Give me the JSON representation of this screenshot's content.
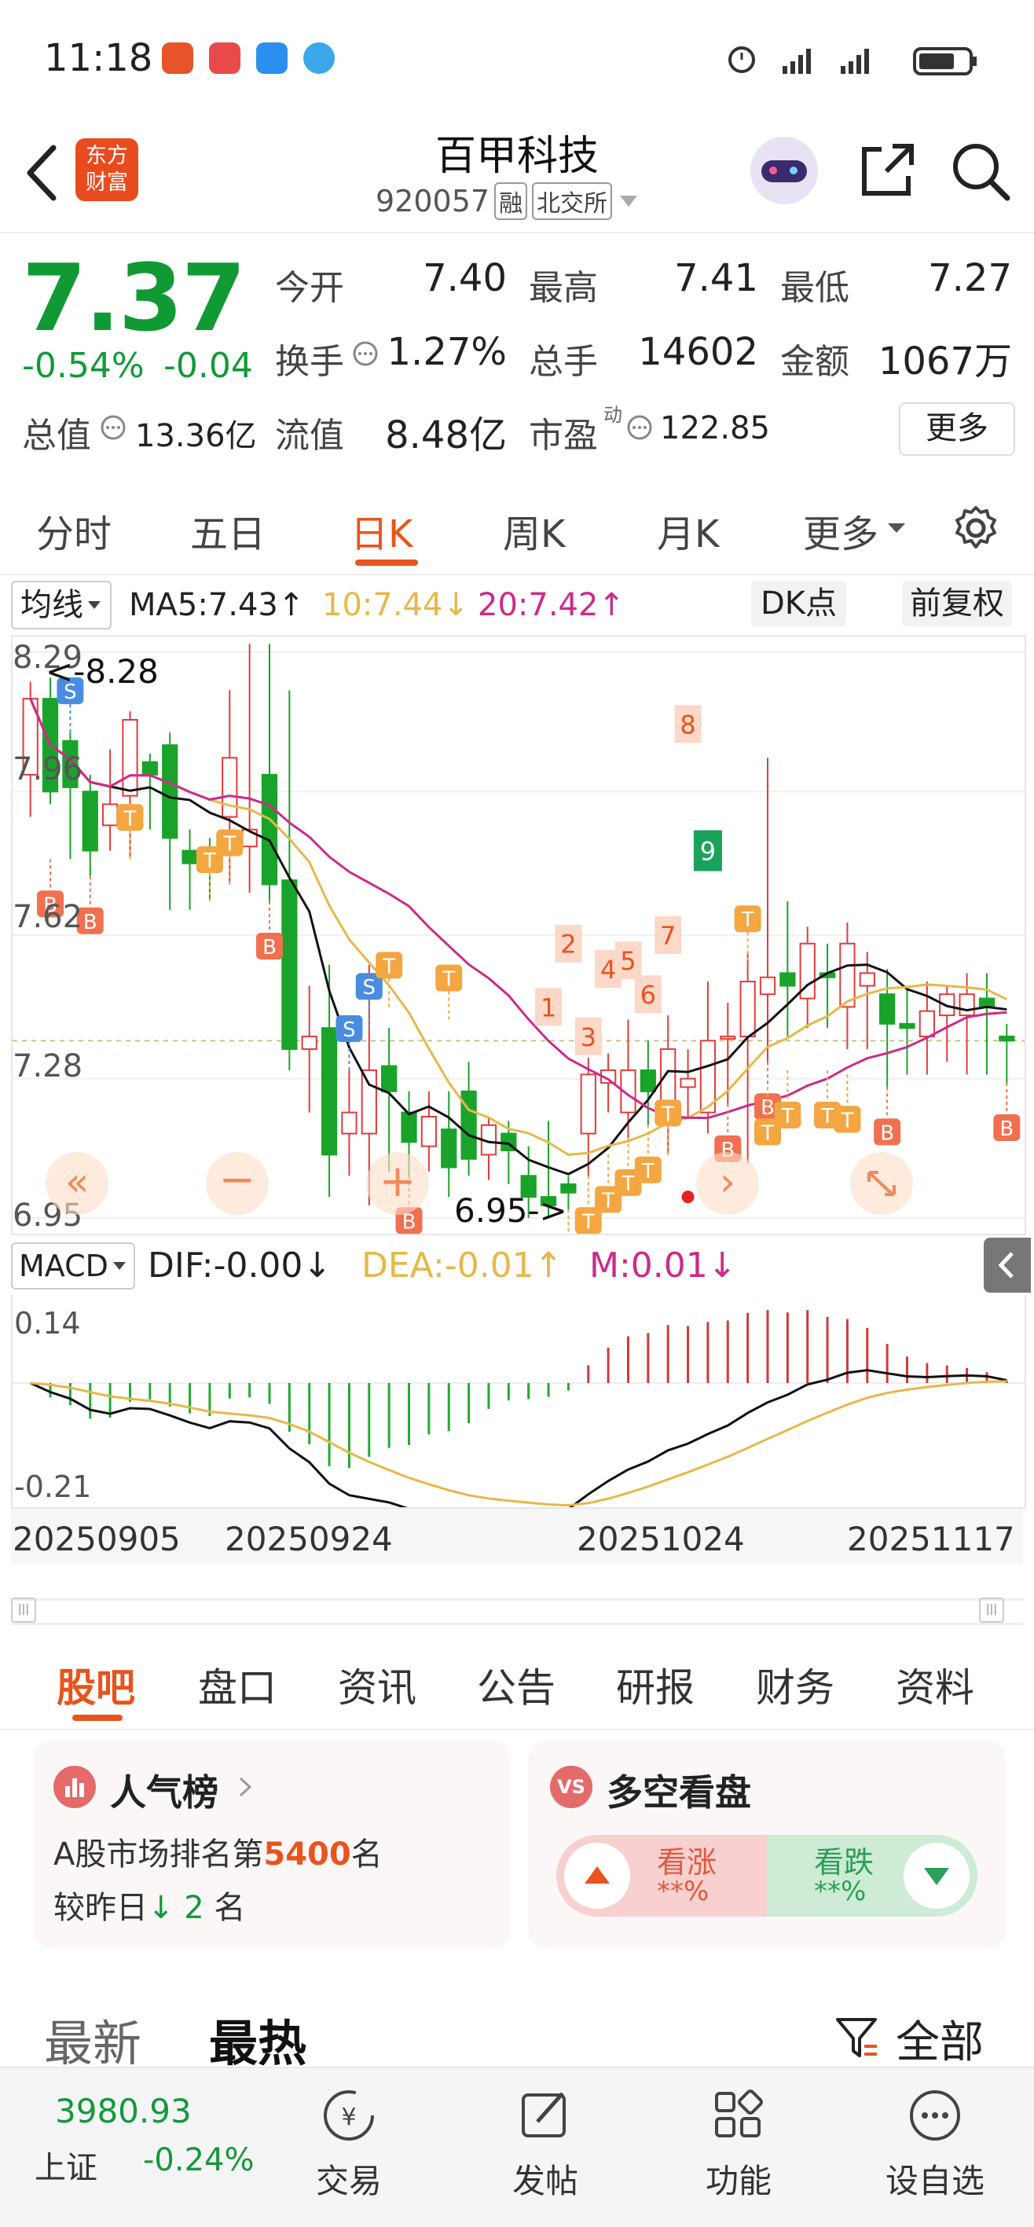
{
  "status": {
    "time": "11:18"
  },
  "header": {
    "title": "百甲科技",
    "code": "920057",
    "tag1": "融",
    "tag2": "北交所",
    "logo_line1": "东方",
    "logo_line2": "财富"
  },
  "quote": {
    "price": "7.37",
    "change_pct": "-0.54%",
    "change": "-0.04",
    "open_label": "今开",
    "open": "7.40",
    "high_label": "最高",
    "high": "7.41",
    "low_label": "最低",
    "low": "7.27",
    "turnover_label": "换手",
    "turnover": "1.27%",
    "volume_label": "总手",
    "volume": "14602",
    "amount_label": "金额",
    "amount": "1067万",
    "mcap_label": "总值",
    "mcap": "13.36亿",
    "float_label": "流值",
    "float": "8.48亿",
    "pe_label": "市盈",
    "pe_sup": "动",
    "pe": "122.85",
    "more": "更多"
  },
  "kline_tabs": [
    "分时",
    "五日",
    "日K",
    "周K",
    "月K",
    "更多"
  ],
  "kline_tab_active": 2,
  "ma": {
    "selector": "均线",
    "ma5": "MA5:7.43↑",
    "ma10": "10:7.44↓",
    "ma20": "20:7.42↑",
    "dk": "DK点",
    "adj": "前复权"
  },
  "chart_labels": {
    "y_ticks": [
      "8.29",
      "7.96",
      "7.62",
      "7.28",
      "6.95"
    ],
    "max_label": "8.28",
    "min_label": "6.95->",
    "macd_top": "0.14",
    "macd_bottom": "-0.21"
  },
  "macd": {
    "selector": "MACD",
    "dif": "DIF:-0.00↓",
    "dea": "DEA:-0.01↑",
    "m": "M:0.01↓"
  },
  "dates": [
    "20250905",
    "20250924",
    "20251024",
    "20251117"
  ],
  "markers": {
    "B": "B",
    "S": "S",
    "T": "T",
    "nums": [
      "1",
      "2",
      "3",
      "4",
      "5",
      "6",
      "7",
      "8",
      "9"
    ]
  },
  "bottom_tabs": [
    "股吧",
    "盘口",
    "资讯",
    "公告",
    "研报",
    "财务",
    "资料"
  ],
  "bottom_tab_active": 0,
  "popularity": {
    "title": "人气榜",
    "line1_pre": "A股市场排名第",
    "rank": "5400",
    "line1_post": "名",
    "line2_pre": "较昨日",
    "change": "2",
    "line2_post": "名"
  },
  "longshort": {
    "title": "多空看盘",
    "up": "看涨",
    "up_pct": "**%",
    "down": "看跌",
    "down_pct": "**%"
  },
  "feed": {
    "tab_new": "最新",
    "tab_hot": "最热",
    "filter": "全部"
  },
  "index": {
    "value": "3980.93",
    "name": "上证",
    "pct": "-0.24%"
  },
  "nav": [
    "交易",
    "发帖",
    "功能",
    "设自选"
  ],
  "chart_data": {
    "type": "candlestick",
    "y_range": [
      6.95,
      8.29
    ],
    "candles": [
      [
        8.0,
        8.18,
        7.9,
        8.22
      ],
      [
        8.18,
        7.96,
        7.93,
        8.23
      ],
      [
        8.08,
        7.97,
        7.8,
        8.1
      ],
      [
        7.96,
        7.82,
        7.76,
        8.0
      ],
      [
        7.88,
        7.93,
        7.82,
        8.06
      ],
      [
        7.95,
        8.13,
        7.8,
        8.15
      ],
      [
        8.03,
        8.0,
        7.87,
        8.05
      ],
      [
        8.07,
        7.85,
        7.68,
        8.1
      ],
      [
        7.82,
        7.79,
        7.68,
        7.87
      ],
      [
        7.8,
        7.78,
        7.7,
        7.85
      ],
      [
        7.9,
        8.04,
        7.74,
        8.2
      ],
      [
        7.83,
        7.87,
        7.72,
        8.31
      ],
      [
        8.0,
        7.74,
        7.7,
        8.31
      ],
      [
        7.75,
        7.35,
        7.3,
        8.2
      ],
      [
        7.35,
        7.38,
        7.2,
        7.5
      ],
      [
        7.4,
        7.1,
        7.0,
        7.55
      ],
      [
        7.15,
        7.2,
        7.05,
        7.3
      ],
      [
        7.15,
        7.3,
        6.98,
        7.55
      ],
      [
        7.31,
        7.25,
        7.06,
        7.4
      ],
      [
        7.2,
        7.13,
        7.05,
        7.25
      ],
      [
        7.12,
        7.19,
        7.06,
        7.25
      ],
      [
        7.16,
        7.07,
        7.0,
        7.25
      ],
      [
        7.25,
        7.09,
        7.05,
        7.32
      ],
      [
        7.1,
        7.17,
        7.04,
        7.19
      ],
      [
        7.15,
        7.11,
        7.03,
        7.18
      ],
      [
        7.05,
        7.0,
        6.95,
        7.12
      ],
      [
        7.0,
        6.98,
        6.95,
        7.18
      ],
      [
        7.03,
        7.01,
        6.97,
        7.05
      ],
      [
        7.15,
        7.29,
        7.05,
        7.33
      ],
      [
        7.27,
        7.3,
        7.2,
        7.34
      ],
      [
        7.2,
        7.3,
        7.14,
        7.42
      ],
      [
        7.3,
        7.25,
        7.17,
        7.37
      ],
      [
        7.22,
        7.35,
        7.1,
        7.43
      ],
      [
        7.26,
        7.28,
        7.19,
        7.35
      ],
      [
        7.2,
        7.37,
        7.15,
        7.51
      ],
      [
        7.38,
        7.38,
        7.22,
        7.46
      ],
      [
        7.38,
        7.51,
        7.08,
        7.58
      ],
      [
        7.48,
        7.52,
        7.32,
        8.04
      ],
      [
        7.53,
        7.5,
        7.38,
        7.7
      ],
      [
        7.47,
        7.6,
        7.4,
        7.64
      ],
      [
        7.53,
        7.52,
        7.4,
        7.6
      ],
      [
        7.45,
        7.6,
        7.35,
        7.65
      ],
      [
        7.5,
        7.53,
        7.35,
        7.58
      ],
      [
        7.48,
        7.41,
        7.26,
        7.54
      ],
      [
        7.41,
        7.4,
        7.29,
        7.5
      ],
      [
        7.38,
        7.44,
        7.29,
        7.51
      ],
      [
        7.43,
        7.48,
        7.32,
        7.5
      ],
      [
        7.43,
        7.48,
        7.29,
        7.53
      ],
      [
        7.47,
        7.45,
        7.29,
        7.53
      ],
      [
        7.38,
        7.37,
        7.27,
        7.41
      ]
    ]
  }
}
